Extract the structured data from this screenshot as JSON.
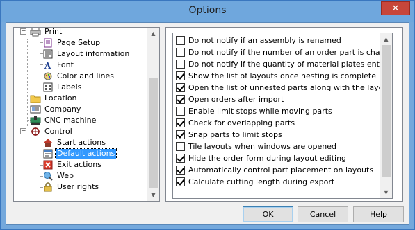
{
  "window": {
    "title": "Options",
    "close_glyph": "✕"
  },
  "tree": {
    "items": [
      {
        "label": "Print",
        "icon": "printer-icon",
        "level": 0,
        "expander": "−"
      },
      {
        "label": "Page Setup",
        "icon": "page-setup-icon",
        "level": 1
      },
      {
        "label": "Layout information",
        "icon": "layout-info-icon",
        "level": 1
      },
      {
        "label": "Font",
        "icon": "font-icon",
        "level": 1
      },
      {
        "label": "Color and lines",
        "icon": "color-lines-icon",
        "level": 1
      },
      {
        "label": "Labels",
        "icon": "labels-icon",
        "level": 1
      },
      {
        "label": "Location",
        "icon": "folder-icon",
        "level": 0
      },
      {
        "label": "Company",
        "icon": "company-icon",
        "level": 0
      },
      {
        "label": "CNC machine",
        "icon": "cnc-machine-icon",
        "level": 0
      },
      {
        "label": "Control",
        "icon": "control-icon",
        "level": 0,
        "expander": "−"
      },
      {
        "label": "Start actions",
        "icon": "start-actions-icon",
        "level": 1
      },
      {
        "label": "Default actions",
        "icon": "default-actions-icon",
        "level": 1,
        "selected": true
      },
      {
        "label": "Exit actions",
        "icon": "exit-actions-icon",
        "level": 1
      },
      {
        "label": "Web",
        "icon": "web-icon",
        "level": 1
      },
      {
        "label": "User rights",
        "icon": "lock-icon",
        "level": 1
      }
    ]
  },
  "options": [
    {
      "label": "Do not notify if an assembly is renamed",
      "checked": false
    },
    {
      "label": "Do not notify if the number of an order part is changed",
      "checked": false
    },
    {
      "label": "Do not notify if the quantity of material plates entered is less",
      "checked": false
    },
    {
      "label": "Show the list of layouts once nesting is complete",
      "checked": true
    },
    {
      "label": "Open the list of unnested parts along with the layout",
      "checked": true
    },
    {
      "label": "Open orders after import",
      "checked": true
    },
    {
      "label": "Enable limit stops while moving parts",
      "checked": false
    },
    {
      "label": "Check for overlapping parts",
      "checked": true
    },
    {
      "label": "Snap parts to limit stops",
      "checked": true
    },
    {
      "label": "Tile layouts when windows are opened",
      "checked": false
    },
    {
      "label": "Hide the order form during layout editing",
      "checked": true
    },
    {
      "label": "Automatically control part placement on layouts",
      "checked": true
    },
    {
      "label": "Calculate cutting length during export",
      "checked": true
    }
  ],
  "buttons": {
    "ok": "OK",
    "cancel": "Cancel",
    "help": "Help"
  },
  "scroll_glyphs": {
    "up": "▲",
    "down": "▼"
  }
}
